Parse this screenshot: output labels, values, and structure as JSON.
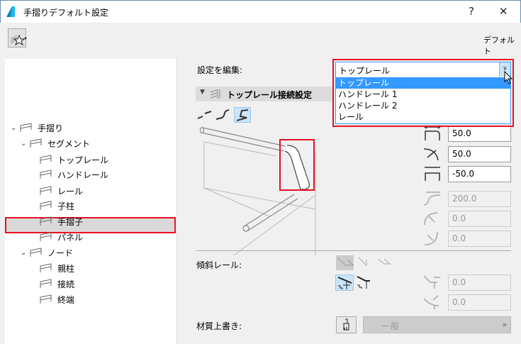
{
  "window": {
    "title": "手摺りデフォルト設定",
    "help": "?",
    "close": "✕"
  },
  "toolbar": {
    "favorites_icon": "railing-star-icon",
    "preset_label": "デフォルト"
  },
  "tree": {
    "items": [
      {
        "label": "手摺り",
        "level": 0,
        "expanded": true
      },
      {
        "label": "セグメント",
        "level": 1,
        "expanded": true
      },
      {
        "label": "トップレール",
        "level": 2
      },
      {
        "label": "ハンドレール",
        "level": 2
      },
      {
        "label": "レール",
        "level": 2
      },
      {
        "label": "子柱",
        "level": 2
      },
      {
        "label": "手摺子",
        "level": 2
      },
      {
        "label": "パネル",
        "level": 2
      },
      {
        "label": "ノード",
        "level": 1,
        "expanded": true
      },
      {
        "label": "親柱",
        "level": 2
      },
      {
        "label": "接続",
        "level": 2,
        "selected": true
      },
      {
        "label": "終端",
        "level": 2
      }
    ]
  },
  "edit": {
    "label": "設定を編集:",
    "selected": "トップレール",
    "options": [
      "トップレール",
      "ハンドレール 1",
      "ハンドレール 2",
      "レール"
    ]
  },
  "section": {
    "title": "トップレール接続設定"
  },
  "fields": {
    "f1": "50.0",
    "f2": "50.0",
    "f3": "-50.0",
    "f4": "200.0",
    "f5": "0.0",
    "f6": "0.0",
    "f7": "0.0",
    "f8": "0.0"
  },
  "sloped": {
    "label": "傾斜レール:"
  },
  "material": {
    "label": "材質上書き:",
    "value": "一般"
  },
  "colors": {
    "accent": "#3399ff",
    "highlight": "#e81123",
    "selected_bg": "#cce4f7"
  }
}
